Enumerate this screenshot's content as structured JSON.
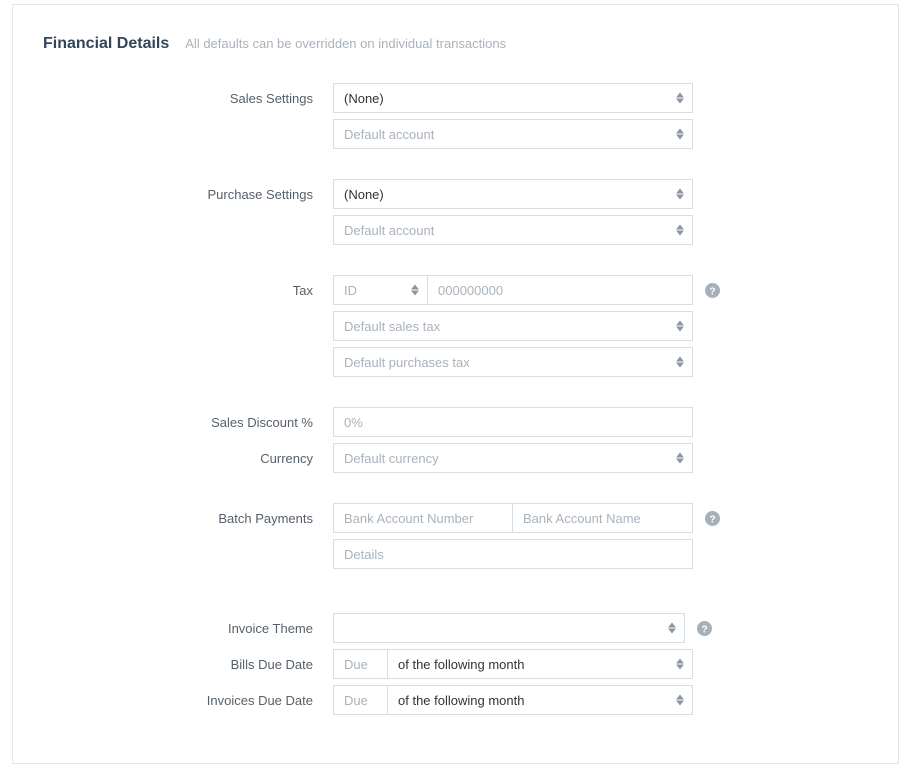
{
  "section": {
    "title": "Financial Details",
    "subtitle": "All defaults can be overridden on individual transactions"
  },
  "labels": {
    "sales_settings": "Sales Settings",
    "purchase_settings": "Purchase Settings",
    "tax": "Tax",
    "sales_discount": "Sales Discount %",
    "currency": "Currency",
    "batch_payments": "Batch Payments",
    "invoice_theme": "Invoice Theme",
    "bills_due_date": "Bills Due Date",
    "invoices_due_date": "Invoices Due Date"
  },
  "fields": {
    "sales_tax_type": {
      "value": "(None)"
    },
    "sales_default_account": {
      "placeholder": "Default account"
    },
    "purchase_tax_type": {
      "value": "(None)"
    },
    "purchase_default_account": {
      "placeholder": "Default account"
    },
    "tax_id_type": {
      "value": "ID"
    },
    "tax_id_number": {
      "placeholder": "000000000"
    },
    "default_sales_tax": {
      "placeholder": "Default sales tax"
    },
    "default_purchases_tax": {
      "placeholder": "Default purchases tax"
    },
    "sales_discount_pct": {
      "placeholder": "0%"
    },
    "currency": {
      "placeholder": "Default currency"
    },
    "bank_account_number": {
      "placeholder": "Bank Account Number"
    },
    "bank_account_name": {
      "placeholder": "Bank Account Name"
    },
    "batch_details": {
      "placeholder": "Details"
    },
    "invoice_theme": {
      "value": ""
    },
    "bills_due_day": {
      "placeholder": "Due"
    },
    "bills_due_period": {
      "value": "of the following month"
    },
    "invoices_due_day": {
      "placeholder": "Due"
    },
    "invoices_due_period": {
      "value": "of the following month"
    }
  }
}
